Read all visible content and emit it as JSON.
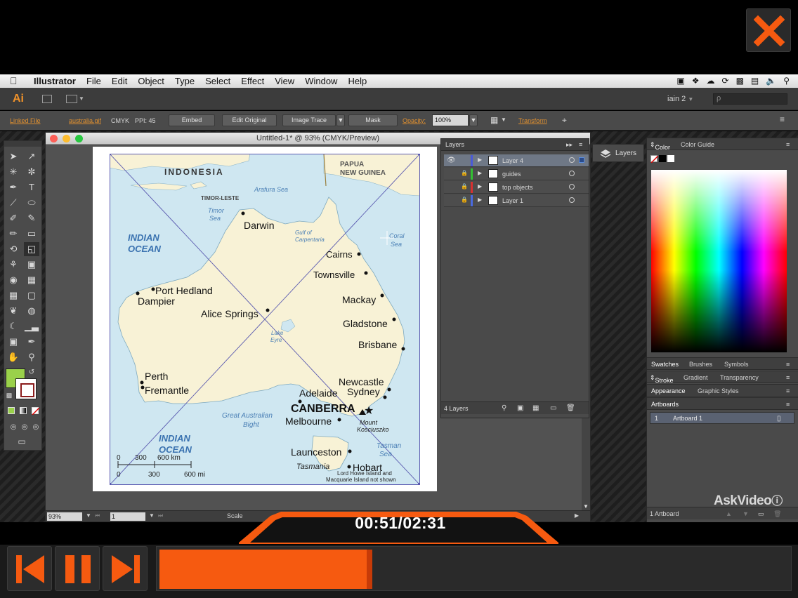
{
  "menubar": {
    "app": "Illustrator",
    "items": [
      "File",
      "Edit",
      "Object",
      "Type",
      "Select",
      "Effect",
      "View",
      "Window",
      "Help"
    ]
  },
  "appbar": {
    "logo": "Ai",
    "workspace": "iain 2",
    "search_placeholder": "ρ"
  },
  "control_bar": {
    "linked_file": "Linked File",
    "file_name": "australia.gif",
    "color_mode": "CMYK",
    "ppi": "PPI: 45",
    "embed": "Embed",
    "edit_original": "Edit Original",
    "image_trace": "Image Trace",
    "mask": "Mask",
    "opacity_label": "Opacity:",
    "opacity_value": "100%",
    "transform": "Transform"
  },
  "document": {
    "title": "Untitled-1* @ 93% (CMYK/Preview)",
    "zoom": "93%",
    "artboard_num": "1",
    "status": "Scale"
  },
  "map_labels": {
    "indonesia": "INDONESIA",
    "png": [
      "PAPUA",
      "NEW GUINEA"
    ],
    "timor_leste": "TIMOR-LESTE",
    "arafura": "Arafura Sea",
    "timor_sea": [
      "Timor",
      "Sea"
    ],
    "carpentaria": [
      "Gulf of",
      "Carpentaria"
    ],
    "coral": [
      "Coral",
      "Sea"
    ],
    "indian_ocean_1": [
      "INDIAN",
      "OCEAN"
    ],
    "indian_ocean_2": [
      "INDIAN",
      "OCEAN"
    ],
    "darwin": "Darwin",
    "cairns": "Cairns",
    "townsville": "Townsville",
    "mackay": "Mackay",
    "port_hedland": "Port Hedland",
    "dampier": "Dampier",
    "alice_springs": "Alice Springs",
    "gladstone": "Gladstone",
    "lake_eyre": [
      "Lake",
      "Eyre"
    ],
    "brisbane": "Brisbane",
    "perth": "Perth",
    "fremantle": "Fremantle",
    "newcastle": "Newcastle",
    "sydney": "Sydney",
    "adelaide": "Adelaide",
    "canberra": "CANBERRA",
    "melbourne": "Melbourne",
    "mount": [
      "Mount",
      "Kosciuszko"
    ],
    "bight": [
      "Great Australian",
      "Bight"
    ],
    "tasman_sea": [
      "Tasman",
      "Sea"
    ],
    "launceston": "Launceston",
    "tasmania": "Tasmania",
    "hobart": "Hobart",
    "scale_km": [
      "0",
      "300",
      "600 km"
    ],
    "scale_mi": [
      "0",
      "300",
      "600 mi"
    ],
    "note": [
      "Lord Howe Island and",
      "Macquarie Island not shown"
    ]
  },
  "layers_panel": {
    "tab": "Layers",
    "layers": [
      {
        "name": "Layer 4",
        "color": "#4a5ad8",
        "selected": true
      },
      {
        "name": "guides",
        "color": "#33c033",
        "selected": false
      },
      {
        "name": "top objects",
        "color": "#d83030",
        "selected": false
      },
      {
        "name": "Layer 1",
        "color": "#4a6ae0",
        "selected": false
      }
    ],
    "count": "4 Layers"
  },
  "dock": {
    "layers_label": "Layers"
  },
  "right_panels": {
    "color_tabs": [
      "Color",
      "Color Guide"
    ],
    "swatch_tabs": [
      "Swatches",
      "Brushes",
      "Symbols"
    ],
    "stroke_tabs": [
      "Stroke",
      "Gradient",
      "Transparency"
    ],
    "appearance_tabs": [
      "Appearance",
      "Graphic Styles"
    ],
    "artboards_tab": "Artboards",
    "artboard_row": {
      "index": "1",
      "name": "Artboard 1"
    },
    "footer": "1 Artboard"
  },
  "watermark": "AskVideo",
  "player": {
    "timecode": "00:51/02:31",
    "progress_fraction": 0.3377,
    "accent": "#f65a10"
  }
}
